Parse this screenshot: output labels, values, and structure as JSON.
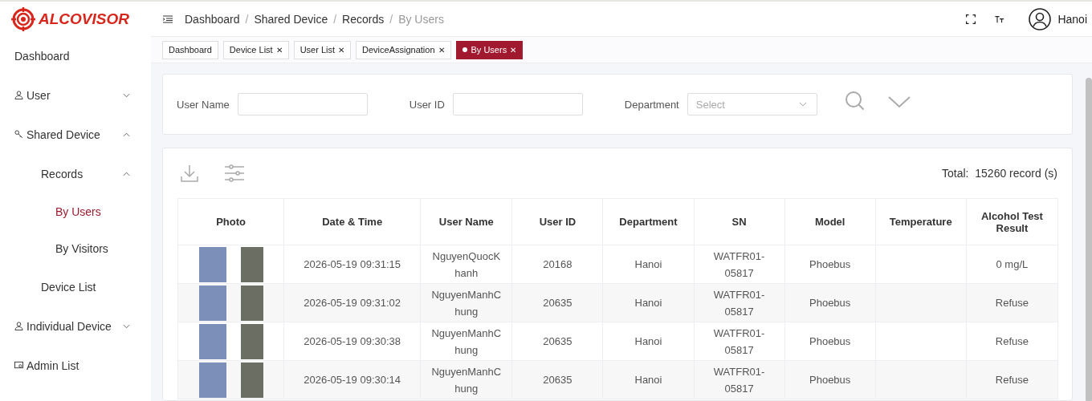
{
  "brand": {
    "name": "ALCOVISOR"
  },
  "breadcrumb": [
    {
      "label": "Dashboard",
      "current": false
    },
    {
      "separator": "/",
      "label": "Shared Device",
      "current": false
    },
    {
      "separator": "/",
      "label": "Records",
      "current": false
    },
    {
      "separator": "/",
      "label": "By Users",
      "current": true
    }
  ],
  "user": {
    "name": "Hanoi"
  },
  "sidebar": {
    "items": [
      {
        "label": "Dashboard",
        "selected": false
      },
      {
        "label": "User",
        "expanded": false,
        "selected": false
      },
      {
        "label": "Shared Device",
        "expanded": true,
        "selected": false,
        "children": [
          {
            "label": "Records",
            "expanded": true,
            "selected": false,
            "children": [
              {
                "label": "By Users",
                "selected": true
              },
              {
                "label": "By Visitors",
                "selected": false
              }
            ]
          },
          {
            "label": "Device List",
            "selected": false
          }
        ]
      },
      {
        "label": "Individual Device",
        "expanded": false,
        "selected": false
      },
      {
        "label": "Admin List",
        "selected": false
      }
    ]
  },
  "tabs": [
    {
      "label": "Dashboard",
      "selected": false
    },
    {
      "label": "Device List",
      "close": "✕",
      "selected": false
    },
    {
      "label": "User List",
      "close": "✕",
      "selected": false
    },
    {
      "label": "DeviceAssignation",
      "close": "✕",
      "selected": false
    },
    {
      "label": "By Users",
      "close": "✕",
      "selected": true
    }
  ],
  "filters": [
    {
      "label": "User Name",
      "kind": "text"
    },
    {
      "label": "User ID",
      "kind": "text"
    },
    {
      "label": "Department",
      "kind": "select",
      "placeholder": "Select"
    }
  ],
  "total": {
    "label": "Total:",
    "value": "15260 record (s)"
  },
  "table": {
    "columns": [
      "Photo",
      "Date & Time",
      "User Name",
      "User ID",
      "Department",
      "SN",
      "Model",
      "Temperature",
      "Alcohol Test Result"
    ],
    "rows": [
      {
        "datetime": "2026-05-19 09:31:15",
        "user_name": "NguyenQuocKhanh",
        "user_id": "20168",
        "department": "Hanoi",
        "sn": "WATFR01-05817",
        "model": "Phoebus",
        "result": "0 mg/L"
      },
      {
        "datetime": "2026-05-19 09:31:02",
        "user_name": "NguyenManhChung",
        "user_id": "20635",
        "department": "Hanoi",
        "sn": "WATFR01-05817",
        "model": "Phoebus",
        "result": "Refuse"
      },
      {
        "datetime": "2026-05-19 09:30:38",
        "user_name": "NguyenManhChung",
        "user_id": "20635",
        "department": "Hanoi",
        "sn": "WATFR01-05817",
        "model": "Phoebus",
        "result": "Refuse"
      },
      {
        "datetime": "2026-05-19 09:30:14",
        "user_name": "NguyenManhChung",
        "user_id": "20635",
        "department": "Hanoi",
        "sn": "WATFR01-05817",
        "model": "Phoebus",
        "result": "Refuse"
      }
    ]
  }
}
